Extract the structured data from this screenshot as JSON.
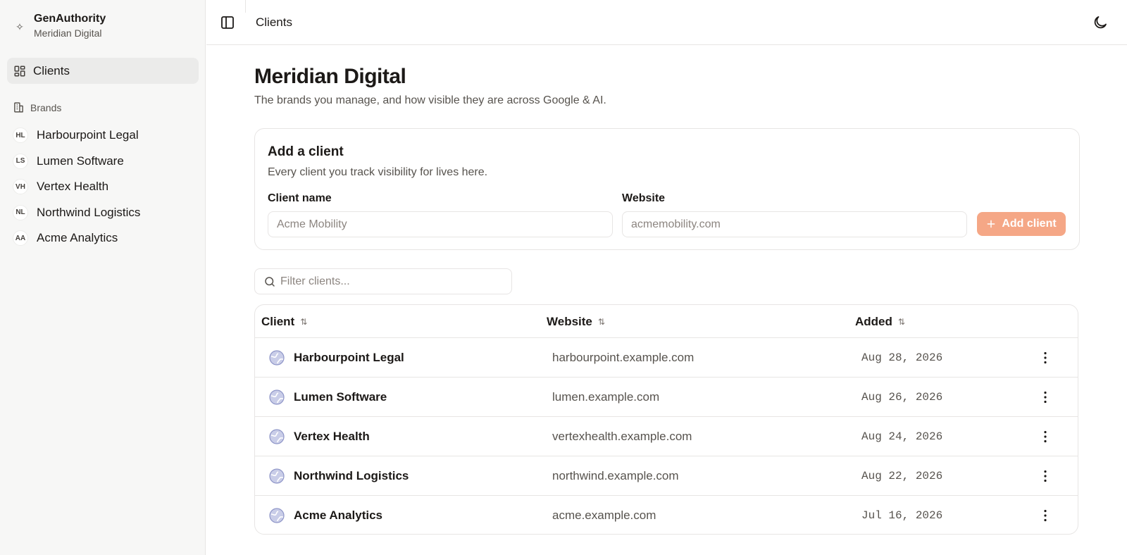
{
  "app": {
    "name": "GenAuthority",
    "workspace": "Meridian Digital"
  },
  "sidebar": {
    "clients_label": "Clients",
    "brands_heading": "Brands",
    "brands": [
      {
        "abbr": "HL",
        "name": "Harbourpoint Legal"
      },
      {
        "abbr": "LS",
        "name": "Lumen Software"
      },
      {
        "abbr": "VH",
        "name": "Vertex Health"
      },
      {
        "abbr": "NL",
        "name": "Northwind Logistics"
      },
      {
        "abbr": "AA",
        "name": "Acme Analytics"
      }
    ]
  },
  "topbar": {
    "title": "Clients"
  },
  "page": {
    "title": "Meridian Digital",
    "subtitle": "The brands you manage, and how visible they are across Google & AI."
  },
  "add_client": {
    "title": "Add a client",
    "subtitle": "Every client you track visibility for lives here.",
    "name_label": "Client name",
    "name_placeholder": "Acme Mobility",
    "website_label": "Website",
    "website_placeholder": "acmemobility.com",
    "button_label": "Add client"
  },
  "filter": {
    "placeholder": "Filter clients..."
  },
  "table": {
    "columns": [
      "Client",
      "Website",
      "Added"
    ],
    "rows": [
      {
        "client": "Harbourpoint Legal",
        "website": "harbourpoint.example.com",
        "added": "Aug 28, 2026"
      },
      {
        "client": "Lumen Software",
        "website": "lumen.example.com",
        "added": "Aug 26, 2026"
      },
      {
        "client": "Vertex Health",
        "website": "vertexhealth.example.com",
        "added": "Aug 24, 2026"
      },
      {
        "client": "Northwind Logistics",
        "website": "northwind.example.com",
        "added": "Aug 22, 2026"
      },
      {
        "client": "Acme Analytics",
        "website": "acme.example.com",
        "added": "Jul 16, 2026"
      }
    ]
  },
  "colors": {
    "accent": "#f5a786",
    "sidebar_bg": "#f7f7f6",
    "border": "#e7e5e4"
  }
}
